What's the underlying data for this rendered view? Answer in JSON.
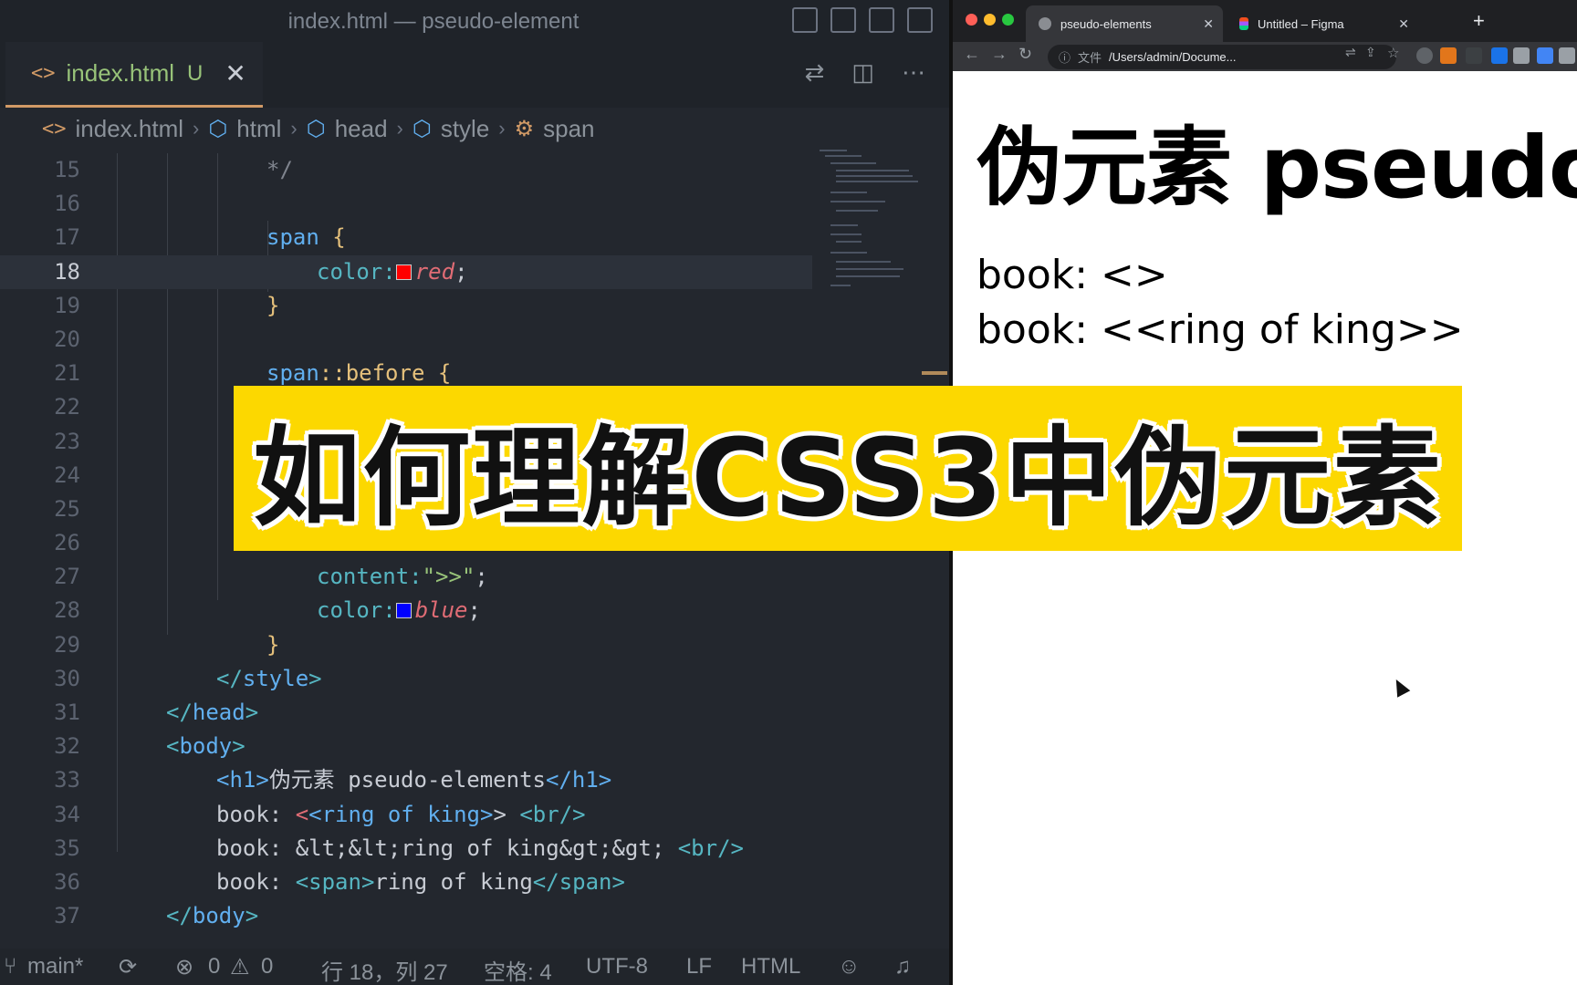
{
  "editor": {
    "window_title": "index.html — pseudo-element",
    "tab": {
      "icon": "<>",
      "filename": "index.html",
      "status": "U",
      "close": "✕"
    },
    "breadcrumb": [
      "index.html",
      "html",
      "head",
      "style",
      "span"
    ],
    "lines": [
      {
        "n": "15"
      },
      {
        "n": "16"
      },
      {
        "n": "17"
      },
      {
        "n": "18"
      },
      {
        "n": "19"
      },
      {
        "n": "20"
      },
      {
        "n": "21"
      },
      {
        "n": "22"
      },
      {
        "n": "23"
      },
      {
        "n": "24"
      },
      {
        "n": "25"
      },
      {
        "n": "26"
      },
      {
        "n": "27"
      },
      {
        "n": "28"
      },
      {
        "n": "29"
      },
      {
        "n": "30"
      },
      {
        "n": "31"
      },
      {
        "n": "32"
      },
      {
        "n": "33"
      },
      {
        "n": "34"
      },
      {
        "n": "35"
      },
      {
        "n": "36"
      },
      {
        "n": "37"
      }
    ],
    "code": {
      "l15": "*/",
      "l17_sel": "span",
      "l17_brace": "{",
      "l18_prop": "color:",
      "l18_val": "red",
      "l18_semi": ";",
      "l19": "}",
      "l21_sel": "span",
      "l21_pseudo": "::before",
      "l21_brace": "{",
      "l27_prop": "content:",
      "l27_str": "\">>\"",
      "l27_semi": ";",
      "l28_prop": "color:",
      "l28_val": "blue",
      "l28_semi": ";",
      "l29": "}",
      "l30_open": "</",
      "l30_tag": "style",
      "l30_close": ">",
      "l31_open": "</",
      "l31_tag": "head",
      "l31_close": ">",
      "l32_open": "<",
      "l32_tag": "body",
      "l32_close": ">",
      "l33_h1o": "<h1>",
      "l33_text": "伪元素 pseudo-elements",
      "l33_h1c": "</h1>",
      "l34_a": "book: ",
      "l34_lt": "<",
      "l34_b": "<ring of king>",
      "l34_gt": ">",
      "l34_br": " <br/>",
      "l35_a": "book: &lt;&lt;ring of king&gt;&gt; ",
      "l35_br": "<br/>",
      "l36_a": "book: ",
      "l36_so": "<span>",
      "l36_b": "ring of king",
      "l36_sc": "</span>",
      "l37_open": "</",
      "l37_tag": "body",
      "l37_close": ">"
    },
    "status": {
      "branch": "main*",
      "errors": "0",
      "warnings": "0",
      "position": "行 18，列 27",
      "indent": "空格: 4",
      "encoding": "UTF-8",
      "eol": "LF",
      "language": "HTML"
    },
    "colors": {
      "red_swatch": "#ff0000",
      "blue_swatch": "#0000ff",
      "accent": "#d19a66"
    }
  },
  "browser": {
    "tabs": [
      {
        "title": "pseudo-elements",
        "active": true
      },
      {
        "title": "Untitled – Figma",
        "active": false
      }
    ],
    "new_tab": "+",
    "address": {
      "scheme_label": "文件",
      "path": "/Users/admin/Docume..."
    },
    "page": {
      "h1": "伪元素 pseudo-elements",
      "line1": "book: <>",
      "line2": "book: <<ring of king>>"
    }
  },
  "banner": {
    "text": "如何理解CSS3中伪元素",
    "color": "#fcd800"
  }
}
